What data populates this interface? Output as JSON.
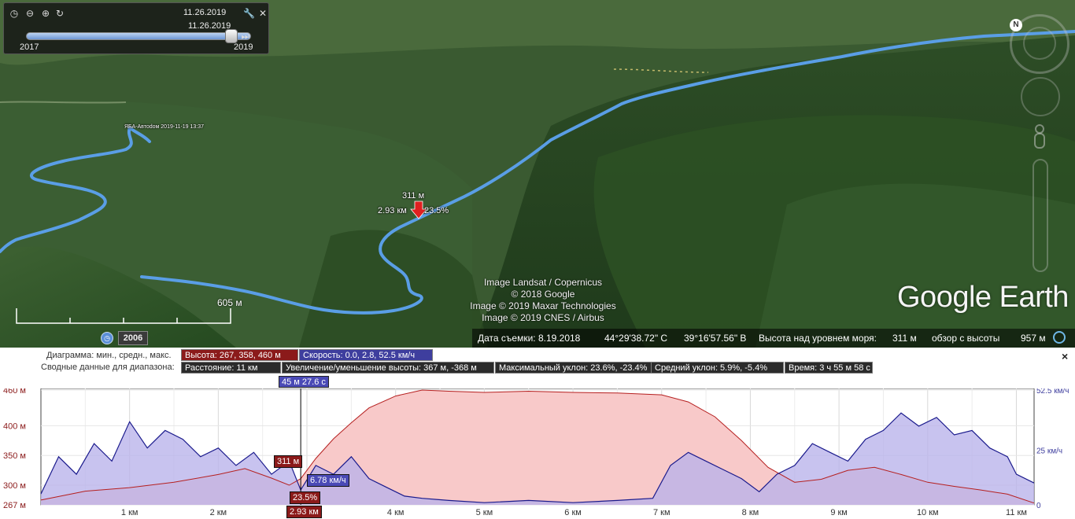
{
  "time_slider": {
    "date_current": "11.26.2019",
    "date_thumb": "11.26.2019",
    "range_start": "2017",
    "range_end": "2019"
  },
  "view": {
    "marker": {
      "elevation": "311 м",
      "distance": "2.93 км",
      "slope": "23.5%"
    },
    "track_label": "ЯБА-Aвтоdoм 2019-11-19 13:37",
    "attribution": [
      "Image Landsat / Copernicus",
      "© 2018 Google",
      "Image © 2019 Maxar Technologies",
      "Image © 2019 CNES / Airbus"
    ],
    "logo": "Google Earth",
    "scale_label": "605 м",
    "history_year": "2006"
  },
  "statusbar": {
    "capture_date": "Дата съемки: 8.19.2018",
    "lat": "44°29'38.72\" С",
    "lon": "39°16'57.56\" В",
    "elevation_label": "Высота над уровнем моря:",
    "elevation_value": "311 м",
    "eye_alt_label": "обзор с высоты",
    "eye_alt_value": "957 м"
  },
  "profile": {
    "chart_label": "Диаграмма: мин., средн., макс.",
    "height_stats": "Высота: 267, 358, 460 м",
    "speed_stats": "Скорость: 0.0, 2.8, 52.5 км/ч",
    "summary_label": "Сводные данные для диапазона:",
    "distance": "Расстояние: 11 км",
    "gain_loss": "Увеличение/уменьшение высоты: 367 м, -368 м",
    "max_slope": "Максимальный уклон: 23.6%, -23.4%",
    "avg_slope": "Средний уклон: 5.9%, -5.4%",
    "time": "Время: 3 ч 55 м 58 с",
    "cursor_time": "45 м 27.6 с",
    "cursor_elev": "311 м",
    "cursor_speed": "6.78 км/ч",
    "cursor_slope": "23.5%",
    "cursor_dist": "2.93 км",
    "close": "×"
  },
  "chart_data": {
    "type": "area",
    "xlabel": "",
    "x_ticks": [
      "1 км",
      "2 км",
      "3 км",
      "4 км",
      "5 км",
      "6 км",
      "7 км",
      "8 км",
      "9 км",
      "10 км",
      "11 км"
    ],
    "y_left_ticks": [
      "460 м",
      "400 м",
      "350 м",
      "300 м",
      "267 м"
    ],
    "y_right_ticks": [
      "52.5 км/ч",
      "25 км/ч",
      "0"
    ],
    "ylim_elev": [
      267,
      460
    ],
    "ylim_speed": [
      0,
      52.5
    ],
    "xlim": [
      0,
      11.2
    ],
    "series": [
      {
        "name": "Высота",
        "color": "#c03030",
        "x": [
          0,
          0.5,
          1,
          1.5,
          2,
          2.3,
          2.6,
          2.8,
          2.93,
          3.1,
          3.3,
          3.5,
          3.7,
          4.0,
          4.3,
          4.6,
          5.0,
          5.5,
          6.0,
          6.5,
          7.0,
          7.3,
          7.6,
          7.9,
          8.2,
          8.5,
          8.8,
          9.1,
          9.4,
          9.7,
          10.0,
          10.3,
          10.6,
          10.9,
          11.2
        ],
        "values": [
          275,
          290,
          296,
          305,
          318,
          328,
          312,
          300,
          311,
          345,
          378,
          405,
          430,
          450,
          460,
          458,
          456,
          458,
          456,
          455,
          452,
          440,
          415,
          375,
          330,
          305,
          310,
          325,
          330,
          318,
          305,
          298,
          292,
          285,
          270
        ]
      },
      {
        "name": "Скорость",
        "color": "#1a1a8c",
        "x": [
          0,
          0.2,
          0.4,
          0.6,
          0.8,
          1.0,
          1.2,
          1.4,
          1.6,
          1.8,
          2.0,
          2.2,
          2.4,
          2.6,
          2.8,
          2.93,
          3.1,
          3.3,
          3.5,
          3.7,
          3.9,
          4.1,
          4.3,
          4.6,
          5.0,
          5.5,
          6.0,
          6.5,
          6.9,
          7.1,
          7.3,
          7.5,
          7.7,
          7.9,
          8.1,
          8.3,
          8.5,
          8.7,
          8.9,
          9.1,
          9.3,
          9.5,
          9.7,
          9.9,
          10.1,
          10.3,
          10.5,
          10.7,
          10.9,
          11.0,
          11.2
        ],
        "values": [
          5,
          22,
          14,
          28,
          20,
          38,
          26,
          34,
          30,
          22,
          26,
          18,
          24,
          14,
          20,
          6.78,
          18,
          14,
          22,
          12,
          8,
          4,
          3,
          2,
          1,
          2,
          1,
          2,
          3,
          18,
          24,
          20,
          16,
          12,
          6,
          14,
          18,
          28,
          24,
          20,
          30,
          34,
          42,
          36,
          40,
          32,
          34,
          26,
          22,
          14,
          10
        ]
      }
    ]
  },
  "colors": {
    "track": "#5a9ee6",
    "elev_fill": "#f7c4c4",
    "speed_fill": "#bcb4e8",
    "marker": "#e02020"
  }
}
